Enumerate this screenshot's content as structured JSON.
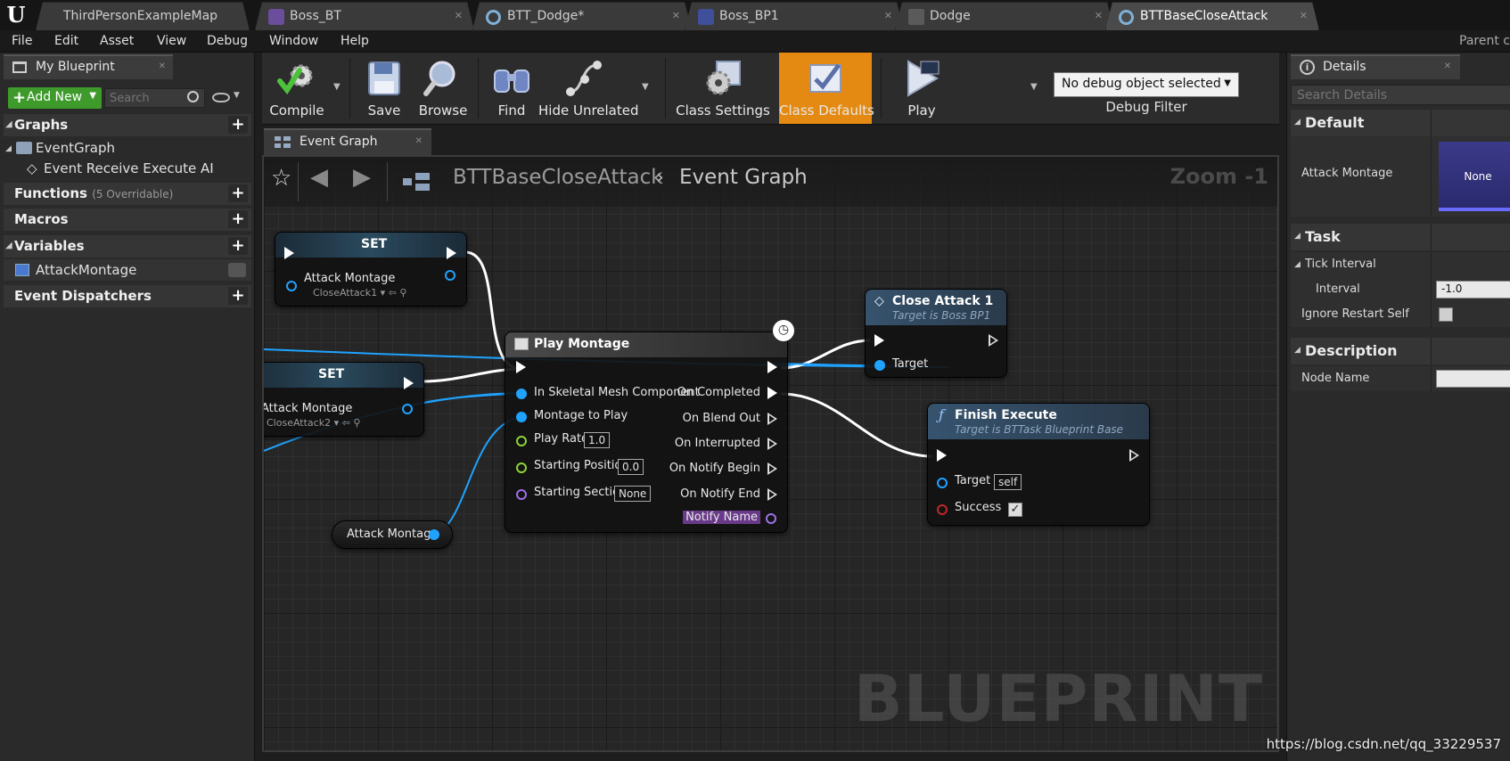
{
  "app": {
    "logo_text": "U",
    "parent_class_label": "Parent c"
  },
  "tabs": [
    {
      "label": "ThirdPersonExampleMap",
      "icon": "ue-logo-icon"
    },
    {
      "label": "Boss_BT",
      "icon": "behavior-tree-icon"
    },
    {
      "label": "BTT_Dodge*",
      "icon": "blueprint-task-icon"
    },
    {
      "label": "Boss_BP1",
      "icon": "blueprint-actor-icon"
    },
    {
      "label": "Dodge",
      "icon": "anim-montage-icon"
    },
    {
      "label": "BTTBaseCloseAttack",
      "icon": "blueprint-task-icon"
    }
  ],
  "menu": [
    "File",
    "Edit",
    "Asset",
    "View",
    "Debug",
    "Window",
    "Help"
  ],
  "my_blueprint": {
    "tab_label": "My Blueprint",
    "add_new_label": "Add New",
    "search_placeholder": "Search",
    "sections": {
      "graphs": "Graphs",
      "functions": "Functions",
      "functions_sub": "(5 Overridable)",
      "macros": "Macros",
      "variables": "Variables",
      "event_dispatchers": "Event Dispatchers"
    },
    "graph_items": [
      "EventGraph",
      "Event Receive Execute AI"
    ],
    "variables": [
      "AttackMontage"
    ]
  },
  "toolbar": {
    "compile": "Compile",
    "save": "Save",
    "browse": "Browse",
    "find": "Find",
    "hide_unrelated": "Hide Unrelated",
    "class_settings": "Class Settings",
    "class_defaults": "Class Defaults",
    "play": "Play",
    "debug_object": "No debug object selected",
    "debug_filter": "Debug Filter"
  },
  "graph": {
    "tab_label": "Event Graph",
    "breadcrumb_root": "BTTBaseCloseAttack",
    "breadcrumb_current": "Event Graph",
    "zoom": "Zoom -1",
    "watermark": "BLUEPRINT",
    "nodes": {
      "set1": {
        "title": "SET",
        "pin": "Attack Montage",
        "value": "CloseAttack1"
      },
      "set2": {
        "title": "SET",
        "pin": "Attack Montage",
        "value": "CloseAttack2"
      },
      "getter": {
        "label": "Attack Montage"
      },
      "play_montage": {
        "title": "Play Montage",
        "inputs": [
          "In Skeletal Mesh Component",
          "Montage to Play",
          "Play Rate",
          "Starting Position",
          "Starting Section"
        ],
        "defaults": {
          "play_rate": "1.0",
          "starting_position": "0.0",
          "starting_section": "None"
        },
        "outputs": [
          "On Completed",
          "On Blend Out",
          "On Interrupted",
          "On Notify Begin",
          "On Notify End",
          "Notify Name"
        ]
      },
      "close_attack": {
        "title": "Close Attack 1",
        "subtitle": "Target is Boss BP1",
        "pin": "Target"
      },
      "finish_execute": {
        "title": "Finish Execute",
        "subtitle": "Target is BTTask Blueprint Base",
        "target": "Target",
        "target_value": "self",
        "success": "Success",
        "success_checked": "✓"
      }
    }
  },
  "details": {
    "tab_label": "Details",
    "search_placeholder": "Search Details",
    "categories": {
      "default": "Default",
      "task": "Task",
      "description": "Description"
    },
    "props": {
      "attack_montage": "Attack Montage",
      "attack_montage_value": "None",
      "tick_interval": "Tick Interval",
      "interval": "Interval",
      "interval_value": "-1.0",
      "ignore_restart_self": "Ignore Restart Self",
      "node_name": "Node Name",
      "node_name_value": ""
    }
  },
  "url_watermark": "https://blog.csdn.net/qq_33229537",
  "colors": {
    "exec": "#ffffff",
    "object_pin": "#1fa3ff",
    "float_pin": "#8ed534",
    "name_pin": "#a070e8",
    "bool_pin": "#c02828",
    "class_defaults_active": "#e48a12",
    "add_new": "#3e9b2b"
  }
}
